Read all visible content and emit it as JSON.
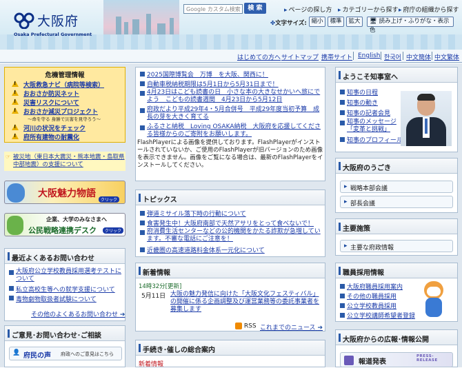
{
  "header": {
    "title": "大阪府",
    "subtitle": "Osaka Prefectural Government",
    "search_placeholder": "Google カスタム検索",
    "search_button": "検 索",
    "top_links": [
      "ページの探し方",
      "カテゴリーから探す",
      "府庁の組織から探す"
    ],
    "text_size_label": "文字サイズ:",
    "text_size_buttons": [
      "縮小",
      "標準",
      "拡大"
    ],
    "read_aloud": "読み上げ・ふりがな・表示色"
  },
  "nav": {
    "links": [
      "はじめての方へ",
      "サイトマップ",
      "携帯サイト",
      "English",
      "한국어",
      "中文簡体",
      "中文繁体"
    ]
  },
  "left": {
    "crisis_title": "危機管理情報",
    "crisis_items": [
      "大阪救急ナビ（病院等検索）",
      "おおさか防災ネット",
      "災害リスクについて",
      "おおさか減災プロジェクト",
      "河川の状況をチェック",
      "府所有建物の耐震化"
    ],
    "crisis_sub": "～命を守る 身勝で災害を見守ろう～",
    "quake_text": "被災地（東日本大震災・熊本地震・島取県中部地震）の支援について",
    "banner1": "大阪魅力物語",
    "banner1_btn": "クリック",
    "banner2_top": "企業、大学のみなさまへ",
    "banner2": "公民戦略連携デスク",
    "banner2_btn": "クリック",
    "faq_title": "最近よくあるお問い合わせ",
    "faq_items": [
      "大阪府公立学校教員採用選考テストについて",
      "私立高校生等への就学支援について",
      "毒物劇物取扱者試験について"
    ],
    "faq_more": "その他のよくあるお問い合わせ",
    "opinion_title": "ご意見･お問い合わせ･ご相談",
    "voice": "府民の声",
    "voice_sub": "府政へのご意見はこちら"
  },
  "center": {
    "news_items": [
      "2025国際博覧会　万博　を大阪、関西に！",
      "自動車税納税期限は5月1日から5月31日まで！",
      "4月23日はこども読書の日　小さな本の大きなせかいへ旅にでよう　こどもの読書週間　4月23日から5月12日",
      "府政だより平成29年4・5月合併号　平成29年度当初予算　成長の芽を大きく育てる",
      "ふるさと納税　Loving OSAKA納税　大阪府を応援してくださる皆様からのご寄附をお願いします。"
    ],
    "flash_notice": "FlashPlayerによる画像を提供しております。FlashPlayerがインストールされていないか、ご使用のFlashPlayerが旧バージョンのため画像を表示できません。画像をご覧になる場合は、最新のFlashPlayerをインストールしてください。",
    "topics_title": "トピックス",
    "topics": [
      "弾道ミサイル落下時の行動について",
      "食害発生中！大阪府南部で天然アサリをとって食べないで！",
      "府消費生活センターなどの公的機関をかたる詐欺が急増しています。不審な電話にご注意を！",
      "近畿圏の高速道路料金体系一元化について"
    ],
    "whatsnew_title": "新着情報",
    "whatsnew_time": "14時32分[更新]",
    "whatsnew_date": "5月11日",
    "whatsnew_text": "大阪の魅力発信に向けた「大阪文化フェスティバル」の開催に係る企画調整及び運営業務等の委託事業者を募集します",
    "rss": "RSS",
    "whatsnew_more": "これまでのニュース",
    "procedures_title": "手続き･催しの総合案内",
    "new_label": "新着情報"
  },
  "right": {
    "governor_title": "ようこそ知事室へ",
    "governor_links": [
      "知事の日程",
      "知事の動き",
      "知事の記者会見",
      "知事のメッセージ「変革と挑戦」",
      "知事のプロフィール"
    ],
    "ugoki_title": "大阪府のうごき",
    "ugoki_buttons": [
      "戦略本部会議",
      "部長会議"
    ],
    "policy_title": "主要施策",
    "policy_button": "主要な府政情報",
    "jobs_title": "職員採用情報",
    "jobs_links": [
      "大阪府職員採用案内",
      "その他の職員採用",
      "公立学校教員採用",
      "公立学校講師希望者登録"
    ],
    "pr_title": "大阪府からの広報･情報公開",
    "press": "報道発表",
    "press_badge": "PRESS-RELEASE"
  }
}
